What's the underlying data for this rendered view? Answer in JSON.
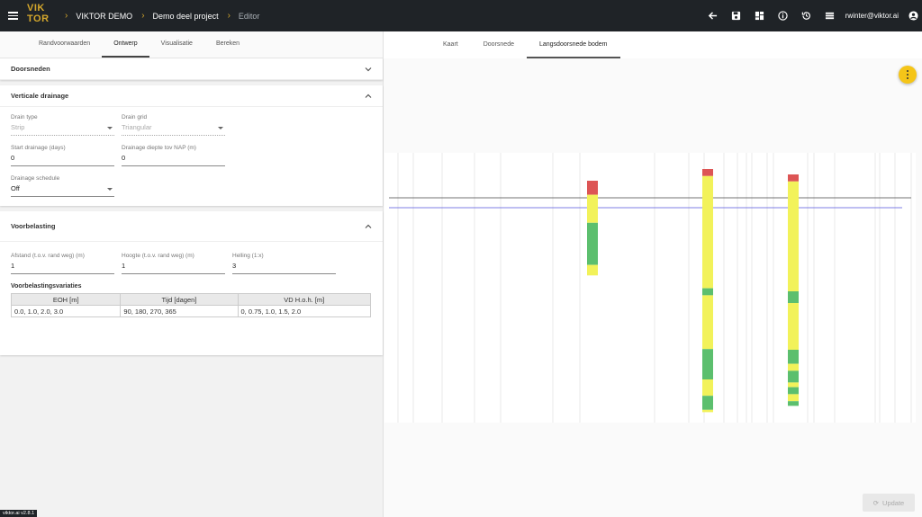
{
  "header": {
    "logo": "VIK TOR",
    "crumbs": [
      "VIKTOR DEMO",
      "Demo deel project",
      "Editor"
    ],
    "user": "rwinter@viktor.ai"
  },
  "left_tabs": [
    "Randvoorwaarden",
    "Ontwerp",
    "Visualisatie",
    "Bereken"
  ],
  "left_active_tab": "Ontwerp",
  "sections": {
    "doorsneden": "Doorsneden",
    "drainage": {
      "title": "Verticale drainage",
      "drain_type_label": "Drain type",
      "drain_type_value": "Strip",
      "drain_grid_label": "Drain grid",
      "drain_grid_value": "Triangular",
      "start_label": "Start drainage (days)",
      "start_value": "0",
      "diepte_label": "Drainage diepte tov NAP (m)",
      "diepte_value": "0",
      "schedule_label": "Drainage schedule",
      "schedule_value": "Off"
    },
    "voorbelasting": {
      "title": "Voorbelasting",
      "afstand_label": "Afstand (t.o.v. rand weg) (m)",
      "afstand_value": "1",
      "hoogte_label": "Hoogte (t.o.v. rand weg) (m)",
      "hoogte_value": "1",
      "helling_label": "Helling (1:x)",
      "helling_value": "3",
      "table_title": "Voorbelastingsvariaties",
      "columns": [
        "EOH [m]",
        "Tijd [dagen]",
        "VD H.o.h. [m]"
      ],
      "row": [
        "0.0, 1.0, 2.0, 3.0",
        "90, 180, 270, 365",
        "0, 0.75, 1.0, 1.5, 2.0"
      ]
    }
  },
  "right_tabs": [
    "Kaart",
    "Doorsnede",
    "Langsdoorsnede bodem"
  ],
  "right_active_tab": "Langsdoorsnede bodem",
  "update_label": "Update",
  "version": "viktor.ai v2.8.1",
  "colors": {
    "clay": "#dd5555",
    "sand": "#f2f25a",
    "peat": "#5cbf6e",
    "line_ref": "#444444",
    "line_water": "#5555dd"
  },
  "profile": {
    "columns": [
      {
        "layers": [
          [
            "clay",
            4
          ],
          [
            "sand",
            8
          ],
          [
            "peat",
            12
          ],
          [
            "sand",
            3
          ]
        ]
      },
      {
        "layers": [
          [
            "clay",
            3
          ],
          [
            "sand",
            48
          ],
          [
            "peat",
            3
          ],
          [
            "sand",
            23
          ],
          [
            "peat",
            13
          ],
          [
            "sand",
            7
          ],
          [
            "peat",
            6
          ],
          [
            "sand",
            1
          ]
        ]
      },
      {
        "layers": [
          [
            "clay",
            3
          ],
          [
            "sand",
            47
          ],
          [
            "peat",
            5
          ],
          [
            "sand",
            20
          ],
          [
            "peat",
            6
          ],
          [
            "sand",
            3
          ],
          [
            "peat",
            5
          ],
          [
            "sand",
            2
          ],
          [
            "peat",
            3
          ],
          [
            "sand",
            3
          ],
          [
            "peat",
            2
          ]
        ]
      }
    ]
  }
}
